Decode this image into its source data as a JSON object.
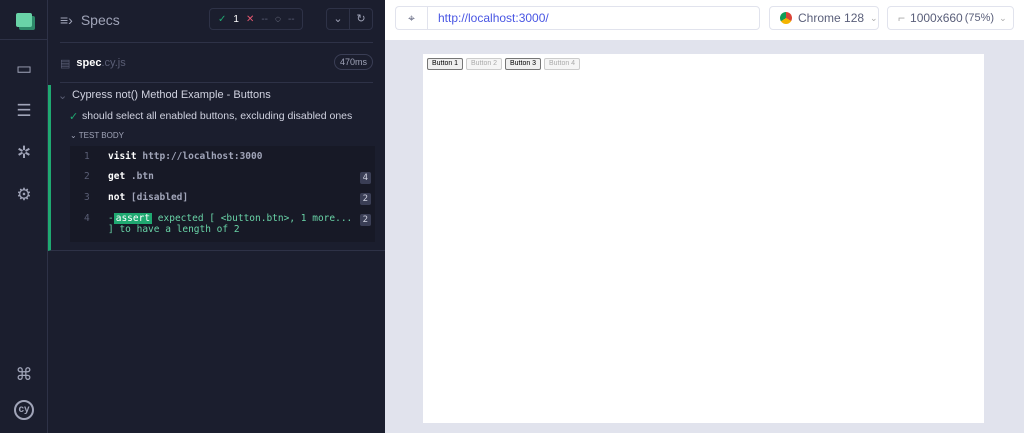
{
  "nav": {
    "items": [
      "specs",
      "runs",
      "debug",
      "settings",
      "keyboard-shortcuts"
    ]
  },
  "reporter": {
    "title": "Specs",
    "passed": "1",
    "failed": "--",
    "pending": "--",
    "spec_name": "spec",
    "spec_ext": ".cy.js",
    "duration": "470ms",
    "suite_title": "Cypress not() Method Example - Buttons",
    "test_title": "should select all enabled buttons, excluding disabled ones",
    "test_body_label": "TEST BODY",
    "commands": [
      {
        "num": "1",
        "name": "visit",
        "message": "http://localhost:3000",
        "count": ""
      },
      {
        "num": "2",
        "name": "get",
        "message": ".btn",
        "count": "4"
      },
      {
        "num": "3",
        "name": "not",
        "message": "[disabled]",
        "count": "2"
      },
      {
        "num": "4",
        "name": "assert",
        "message": "expected [ <button.btn>, 1 more...",
        "message2": "] to have a length of 2",
        "count": "2"
      }
    ]
  },
  "browser": {
    "url": "http://localhost:3000/",
    "name": "Chrome 128",
    "viewport": "1000x660",
    "scale": "(75%)"
  },
  "aut": {
    "buttons": [
      {
        "label": "Button 1",
        "disabled": false
      },
      {
        "label": "Button 2",
        "disabled": true
      },
      {
        "label": "Button 3",
        "disabled": false
      },
      {
        "label": "Button 4",
        "disabled": true
      }
    ]
  }
}
